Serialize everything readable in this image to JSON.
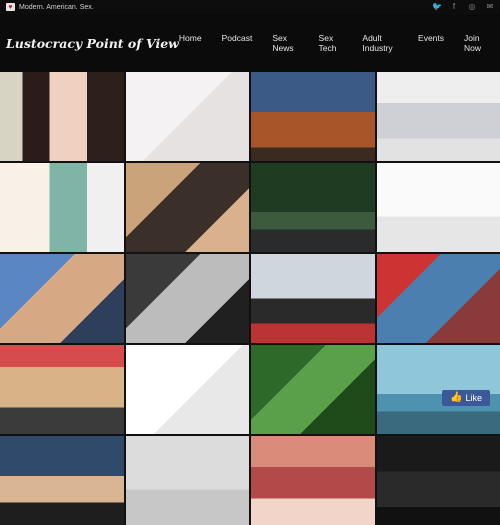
{
  "topbar": {
    "tagline": "Modern. American. Sex.",
    "icons": [
      "heart-logo-icon",
      "twitter-icon",
      "facebook-icon",
      "instagram-icon",
      "mail-icon"
    ]
  },
  "nav": {
    "logo": "Lustocracy Point of View",
    "items": [
      "Home",
      "Podcast",
      "Sex News",
      "Sex Tech",
      "Adult Industry",
      "Events",
      "Join Now"
    ]
  },
  "grid": {
    "tiles": [
      {
        "icon": "photo-icon"
      },
      {
        "icon": "photo-icon"
      },
      {
        "icon": "photo-icon"
      },
      {
        "icon": "photo-icon"
      },
      {
        "icon": "photo-icon"
      },
      {
        "icon": "photo-icon"
      },
      {
        "icon": "photo-icon"
      },
      {
        "icon": "photo-icon"
      },
      {
        "icon": "photo-icon"
      },
      {
        "icon": "photo-icon"
      },
      {
        "icon": "photo-icon"
      },
      {
        "icon": "photo-icon"
      },
      {
        "icon": "photo-icon"
      },
      {
        "icon": "photo-icon"
      },
      {
        "icon": "photo-icon"
      },
      {
        "icon": "photo-icon",
        "badge": "Like"
      },
      {
        "icon": "photo-icon"
      },
      {
        "icon": "photo-icon"
      },
      {
        "icon": "photo-icon"
      },
      {
        "icon": "photo-icon"
      }
    ]
  },
  "colors": {
    "background": "#111111",
    "nav_text": "#e6e6e6",
    "accent_heart": "#d0162f",
    "like_badge": "#3b5998"
  }
}
